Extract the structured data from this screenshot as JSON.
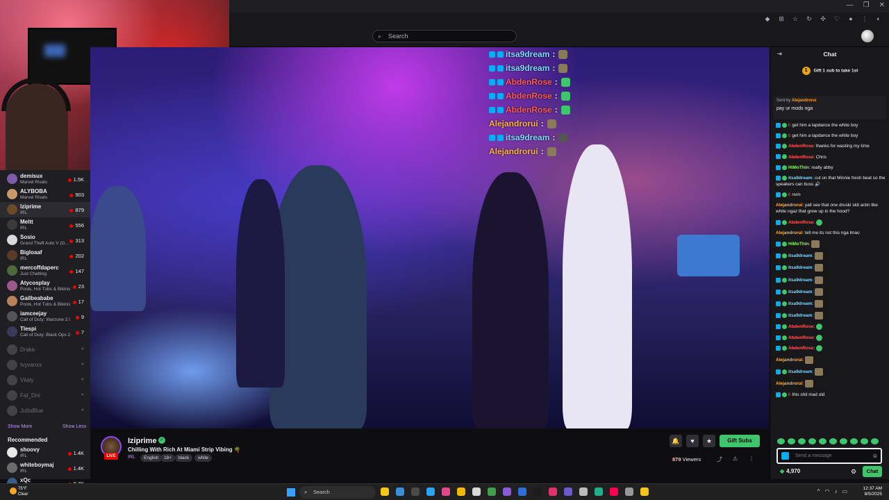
{
  "browser": {
    "window_controls": [
      "—",
      "❐",
      "✕"
    ],
    "toolbar_icons": [
      "tag-icon",
      "grid-icon",
      "star-icon",
      "refresh-icon",
      "puzzle-icon",
      "bookmark-icon",
      "profile-icon",
      "menu-icon",
      "extension-icon"
    ]
  },
  "topnav": {
    "search_placeholder": "Search"
  },
  "sidebar": {
    "channels": [
      {
        "name": "demisux",
        "game": "Marvel Rivals",
        "viewers": "1.5K",
        "color": "#7b5ea7"
      },
      {
        "name": "ALYBOBA",
        "game": "Marvel Rivals",
        "viewers": "903",
        "color": "#c79a6b"
      },
      {
        "name": "Iziprime",
        "game": "IRL",
        "viewers": "879",
        "color": "#6b4a2a",
        "active": true
      },
      {
        "name": "Meltt",
        "game": "IRL",
        "viewers": "556",
        "color": "#3b3b3b"
      },
      {
        "name": "Sosio",
        "game": "Grand Theft Auto V (G...",
        "viewers": "313",
        "color": "#d9d9d9"
      },
      {
        "name": "Bigloaaf",
        "game": "IRL",
        "viewers": "202",
        "color": "#5a3a2a"
      },
      {
        "name": "mercoffdaperc",
        "game": "Just Chatting",
        "viewers": "147",
        "color": "#4a6a3a"
      },
      {
        "name": "Atycosplay",
        "game": "Pools, Hot Tubs & Bikinis",
        "viewers": "23",
        "color": "#9a5a8a"
      },
      {
        "name": "Gailbeababe",
        "game": "Pools, Hot Tubs & Bikinis",
        "viewers": "17",
        "color": "#b5825a"
      },
      {
        "name": "iamceejay",
        "game": "Call of Duty: Warzone 2.0",
        "viewers": "9",
        "color": "#555"
      },
      {
        "name": "Tlespi",
        "game": "Call of Duty: Black Ops 2...",
        "viewers": "7",
        "color": "#3a3a5a"
      }
    ],
    "offline": [
      "Drake",
      "Ivyvanxx",
      "Vitaly",
      "Fat_Dre",
      "JuttaBlue"
    ],
    "show_more": "Show More",
    "show_less": "Show Less",
    "recommended_title": "Recommended",
    "recommended": [
      {
        "name": "shoovy",
        "game": "IRL",
        "viewers": "1.4K",
        "color": "#e8e8e8"
      },
      {
        "name": "whiteboymaj",
        "game": "IRL",
        "viewers": "1.4K",
        "color": "#6b6b6b"
      },
      {
        "name": "xQc",
        "game": "",
        "viewers": "8.7K",
        "color": "#3a5a8a"
      }
    ]
  },
  "video_overlay": [
    {
      "user": "itsa9dream",
      "color": "#7ed9ff",
      "emote": "#8a7a5a"
    },
    {
      "user": "itsa9dream",
      "color": "#7ed9ff",
      "emote": "#8a7a5a"
    },
    {
      "user": "AbdenRose",
      "color": "#ff5a5a",
      "emote": "#3fc56c"
    },
    {
      "user": "AbdenRose",
      "color": "#ff5a5a",
      "emote": "#3fc56c"
    },
    {
      "user": "AbdenRose",
      "color": "#ff5a5a",
      "emote": "#3fc56c"
    },
    {
      "user": "Alejandrorui",
      "color": "#ffb347",
      "emote": "#8a7a5a"
    },
    {
      "user": "itsa9dream",
      "color": "#7ed9ff",
      "emote": "#555"
    },
    {
      "user": "Alejandrorui",
      "color": "#ffb347",
      "emote": "#8a7a5a"
    }
  ],
  "overlay_separator": ":",
  "stream": {
    "streamer": "Iziprime",
    "title": "Chilling With Rich At Miami Strip Vibing 🌴",
    "category": "IRL",
    "tags": [
      "English",
      "18+",
      "black",
      "white"
    ],
    "live_label": "LIVE",
    "viewers": "879",
    "viewers_label": "Viewers",
    "gift_button": "Gift Subs",
    "verified": "✓"
  },
  "chat": {
    "header": "Chat",
    "gift_banner": "Gift 1 sub to take 1st",
    "gift_rank": "1",
    "pinned_by_label": "Sent by",
    "pinned_by": "Alejandrorui",
    "pinned_text": "pay ur mods nga",
    "messages": [
      {
        "user": "l",
        "color": "#ff4a4a",
        "text": ": get him a lapdance the white boy"
      },
      {
        "user": "l",
        "color": "#ff4a4a",
        "text": ": get him a lapdance the white boy"
      },
      {
        "user": "AbdenRose",
        "color": "#ff5a5a",
        "text": ": thanks for wasting my time"
      },
      {
        "user": "AbdenRose",
        "color": "#ff5a5a",
        "text": ": Chris"
      },
      {
        "user": "HiMoThin",
        "color": "#8aff5a",
        "text": ": really abby"
      },
      {
        "user": "itsa9dream",
        "color": "#7ed9ff",
        "text": ": cut on that Minnie fresh beat so the speakers can buss 🔊"
      },
      {
        "user": "l",
        "color": "#ff4a4a",
        "text": ": nvm"
      },
      {
        "user": "Alejandrorui",
        "color": "#ffb347",
        "text": ": yall see that one druski skit actin like white ngaz that grew up in the hood?"
      },
      {
        "user": "AbdenRose",
        "color": "#ff5a5a",
        "text": ":"
      },
      {
        "user": "Alejandrorui",
        "color": "#ffb347",
        "text": ": tell me its not this nga lmao"
      },
      {
        "user": "HiMoThin",
        "color": "#8aff5a",
        "text": ":"
      },
      {
        "user": "itsa9dream",
        "color": "#7ed9ff",
        "text": ":"
      },
      {
        "user": "itsa9dream",
        "color": "#7ed9ff",
        "text": ":"
      },
      {
        "user": "itsa9dream",
        "color": "#7ed9ff",
        "text": ":"
      },
      {
        "user": "itsa9dream",
        "color": "#7ed9ff",
        "text": ":"
      },
      {
        "user": "itsa9dream",
        "color": "#7ed9ff",
        "text": ":"
      },
      {
        "user": "itsa9dream",
        "color": "#7ed9ff",
        "text": ":"
      },
      {
        "user": "AbdenRose",
        "color": "#ff5a5a",
        "text": ":"
      },
      {
        "user": "AbdenRose",
        "color": "#ff5a5a",
        "text": ":"
      },
      {
        "user": "AbdenRose",
        "color": "#ff5a5a",
        "text": ":"
      },
      {
        "user": "Alejandrorui",
        "color": "#ffb347",
        "text": ":"
      },
      {
        "user": "itsa9dream",
        "color": "#7ed9ff",
        "text": ":"
      },
      {
        "user": "Alejandrorui",
        "color": "#ffb347",
        "text": ":"
      },
      {
        "user": "l",
        "color": "#ff4a4a",
        "text": ": this shit mad old"
      }
    ],
    "input_placeholder": "Send a message",
    "points": "4,970",
    "chat_button": "Chat"
  },
  "taskbar": {
    "weather_temp": "75°F",
    "weather_desc": "Clear",
    "search": "Search",
    "time": "12:37 AM",
    "date": "8/5/2025",
    "apps": [
      "#f5c518",
      "#3a8fd9",
      "#4a4a4a",
      "#2ea3f2",
      "#e04a8a",
      "#f2b705",
      "#d9d9d9",
      "#3ea04a",
      "#8a5ad9",
      "#2f6fd9",
      "#1b1b1b",
      "#e1306c",
      "#6a5acd",
      "#bbbbbb",
      "#1faf8a",
      "#ff0050",
      "#999",
      "#f5c518"
    ]
  }
}
